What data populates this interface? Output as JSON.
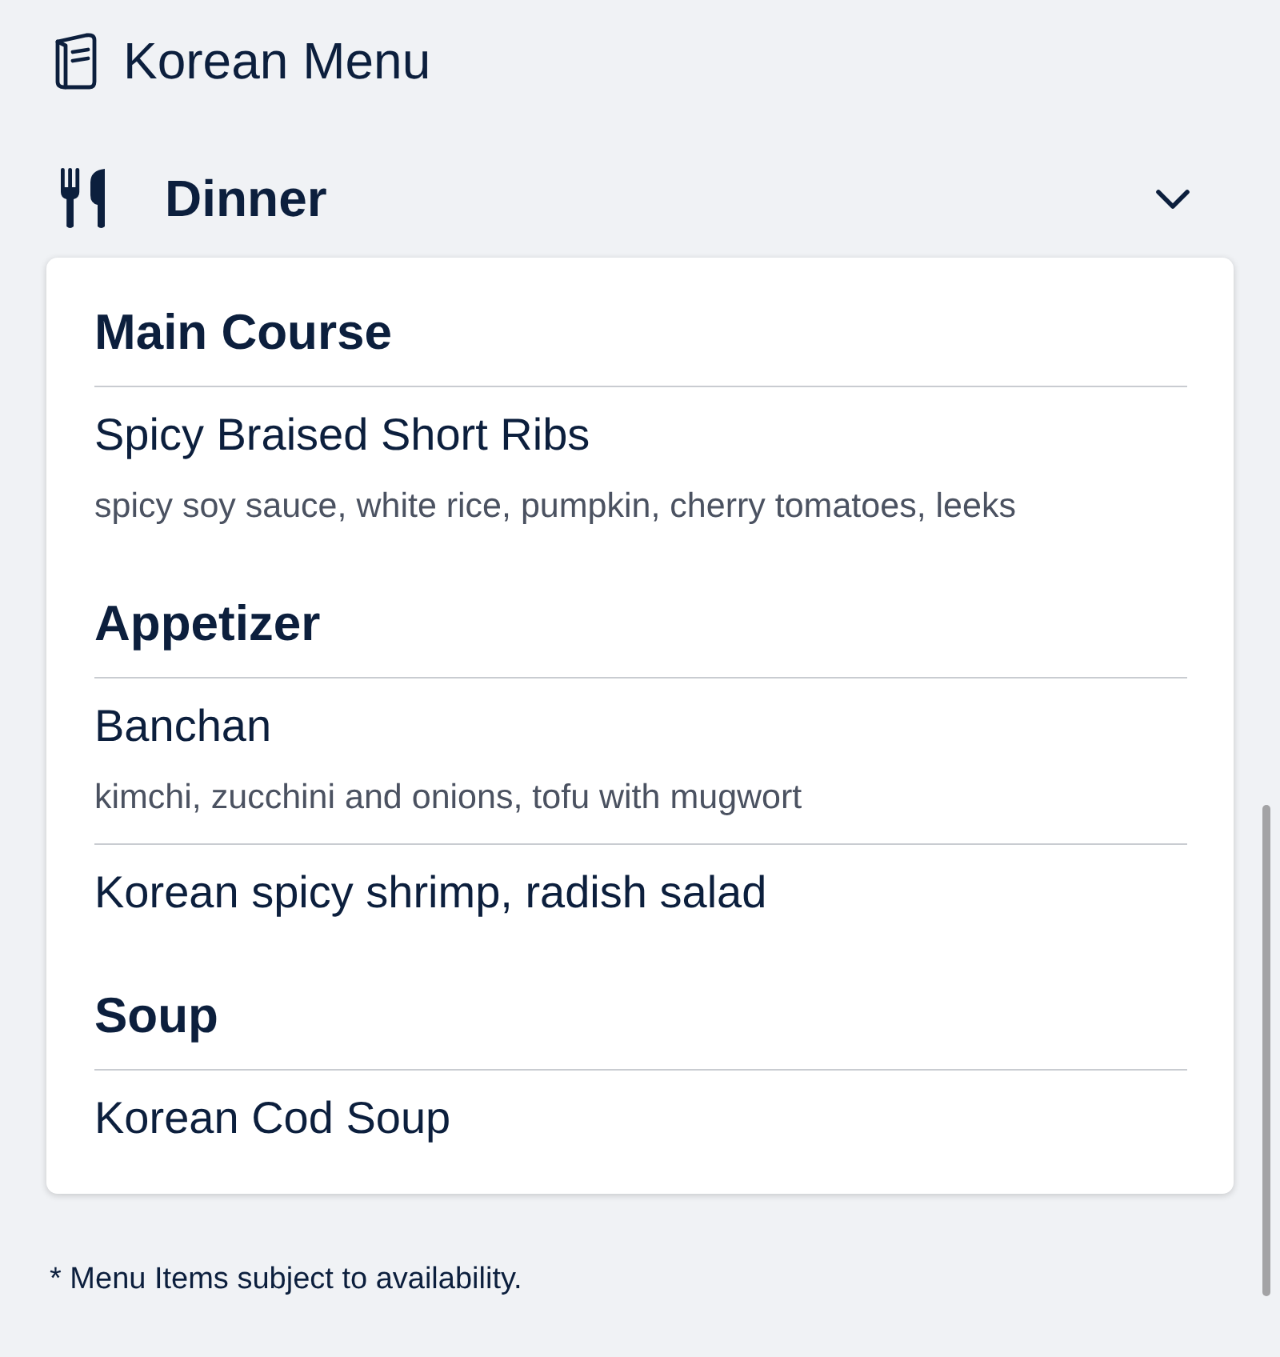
{
  "header": {
    "title": "Korean Menu"
  },
  "meal": {
    "title": "Dinner",
    "expanded": true,
    "sections": [
      {
        "heading": "Main Course",
        "items": [
          {
            "name": "Spicy Braised Short Ribs",
            "description": "spicy soy sauce, white rice, pumpkin, cherry tomatoes, leeks"
          }
        ]
      },
      {
        "heading": "Appetizer",
        "items": [
          {
            "name": "Banchan",
            "description": "kimchi, zucchini and onions, tofu with mugwort"
          },
          {
            "name": "Korean spicy shrimp, radish salad"
          }
        ]
      },
      {
        "heading": "Soup",
        "items": [
          {
            "name": "Korean Cod Soup"
          }
        ]
      }
    ]
  },
  "footnote": "* Menu Items subject to availability."
}
